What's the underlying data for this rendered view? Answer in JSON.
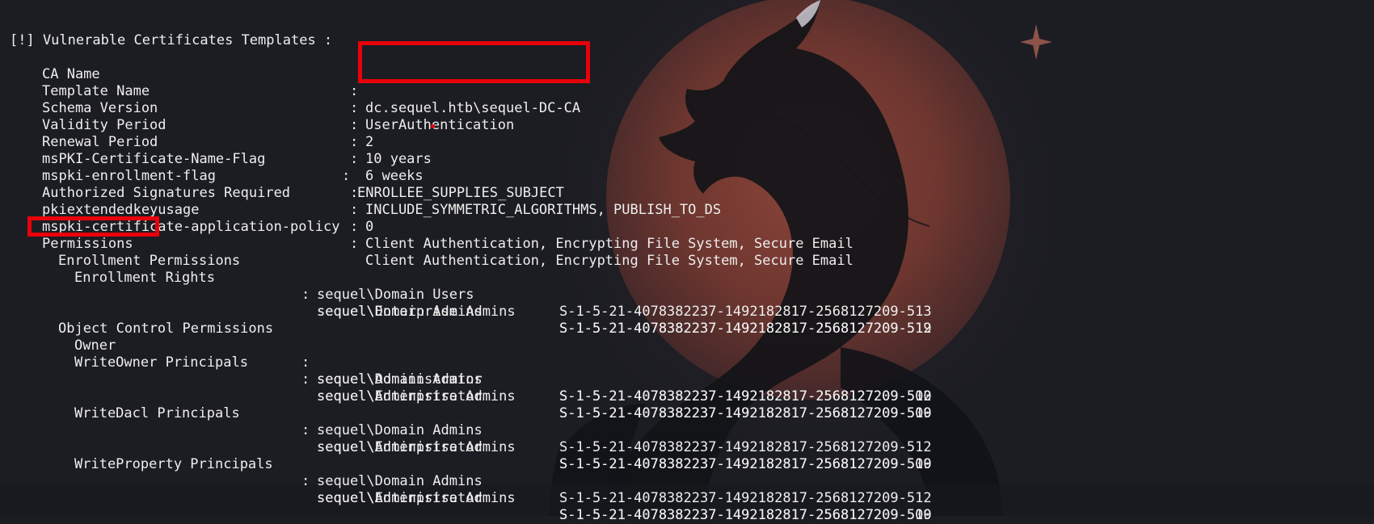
{
  "header": "[!] Vulnerable Certificates Templates :",
  "fields": [
    {
      "key": "CA Name",
      "value": "dc.sequel.htb\\sequel-DC-CA"
    },
    {
      "key": "Template Name",
      "value": "UserAuthentication"
    },
    {
      "key": "Schema Version",
      "value": "2"
    },
    {
      "key": "Validity Period",
      "value": "10 years"
    },
    {
      "key": "Renewal Period",
      "value": "6 weeks"
    },
    {
      "key": "msPKI-Certificate-Name-Flag",
      "value": "ENROLLEE_SUPPLIES_SUBJECT"
    },
    {
      "key": "mspki-enrollment-flag",
      "value": "INCLUDE_SYMMETRIC_ALGORITHMS, PUBLISH_TO_DS"
    },
    {
      "key": "Authorized Signatures Required",
      "value": "0"
    },
    {
      "key": "pkiextendedkeyusage",
      "value": "Client Authentication, Encrypting File System, Secure Email"
    },
    {
      "key": "mspki-certificate-application-policy",
      "value": "Client Authentication, Encrypting File System, Secure Email"
    }
  ],
  "permissions": {
    "title": "Permissions",
    "enrollment": {
      "title": "Enrollment Permissions",
      "rights_label": "Enrollment Rights",
      "rows": [
        {
          "principal": "sequel\\Domain Admins",
          "sid": "S-1-5-21-4078382237-1492182817-2568127209-512"
        },
        {
          "principal": "sequel\\Domain Users",
          "sid": "S-1-5-21-4078382237-1492182817-2568127209-513"
        },
        {
          "principal": "sequel\\Enterprise Admins",
          "sid": "S-1-5-21-4078382237-1492182817-2568127209-519"
        }
      ]
    },
    "object_control": {
      "title": "Object Control Permissions",
      "owner": {
        "label": "Owner",
        "principal": "sequel\\Administrator",
        "sid": "S-1-5-21-4078382237-1492182817-2568127209-500"
      },
      "write_owner": {
        "label": "WriteOwner Principals",
        "rows": [
          {
            "principal": "sequel\\Administrator",
            "sid": "S-1-5-21-4078382237-1492182817-2568127209-500"
          },
          {
            "principal": "sequel\\Domain Admins",
            "sid": "S-1-5-21-4078382237-1492182817-2568127209-512"
          },
          {
            "principal": "sequel\\Enterprise Admins",
            "sid": "S-1-5-21-4078382237-1492182817-2568127209-519"
          }
        ]
      },
      "write_dacl": {
        "label": "WriteDacl Principals",
        "rows": [
          {
            "principal": "sequel\\Administrator",
            "sid": "S-1-5-21-4078382237-1492182817-2568127209-500"
          },
          {
            "principal": "sequel\\Domain Admins",
            "sid": "S-1-5-21-4078382237-1492182817-2568127209-512"
          },
          {
            "principal": "sequel\\Enterprise Admins",
            "sid": "S-1-5-21-4078382237-1492182817-2568127209-519"
          }
        ]
      },
      "write_property": {
        "label": "WriteProperty Principals",
        "rows": [
          {
            "principal": "sequel\\Administrator",
            "sid": "S-1-5-21-4078382237-1492182817-2568127209-500"
          },
          {
            "principal": "sequel\\Domain Admins",
            "sid": "S-1-5-21-4078382237-1492182817-2568127209-512"
          },
          {
            "principal": "sequel\\Enterprise Admins",
            "sid": "S-1-5-21-4078382237-1492182817-2568127209-519"
          }
        ]
      }
    }
  },
  "theme": {
    "background": "#1c1d23",
    "text": "#eeeeee",
    "highlight": "#e8000b",
    "moon": "#8a3d32"
  }
}
